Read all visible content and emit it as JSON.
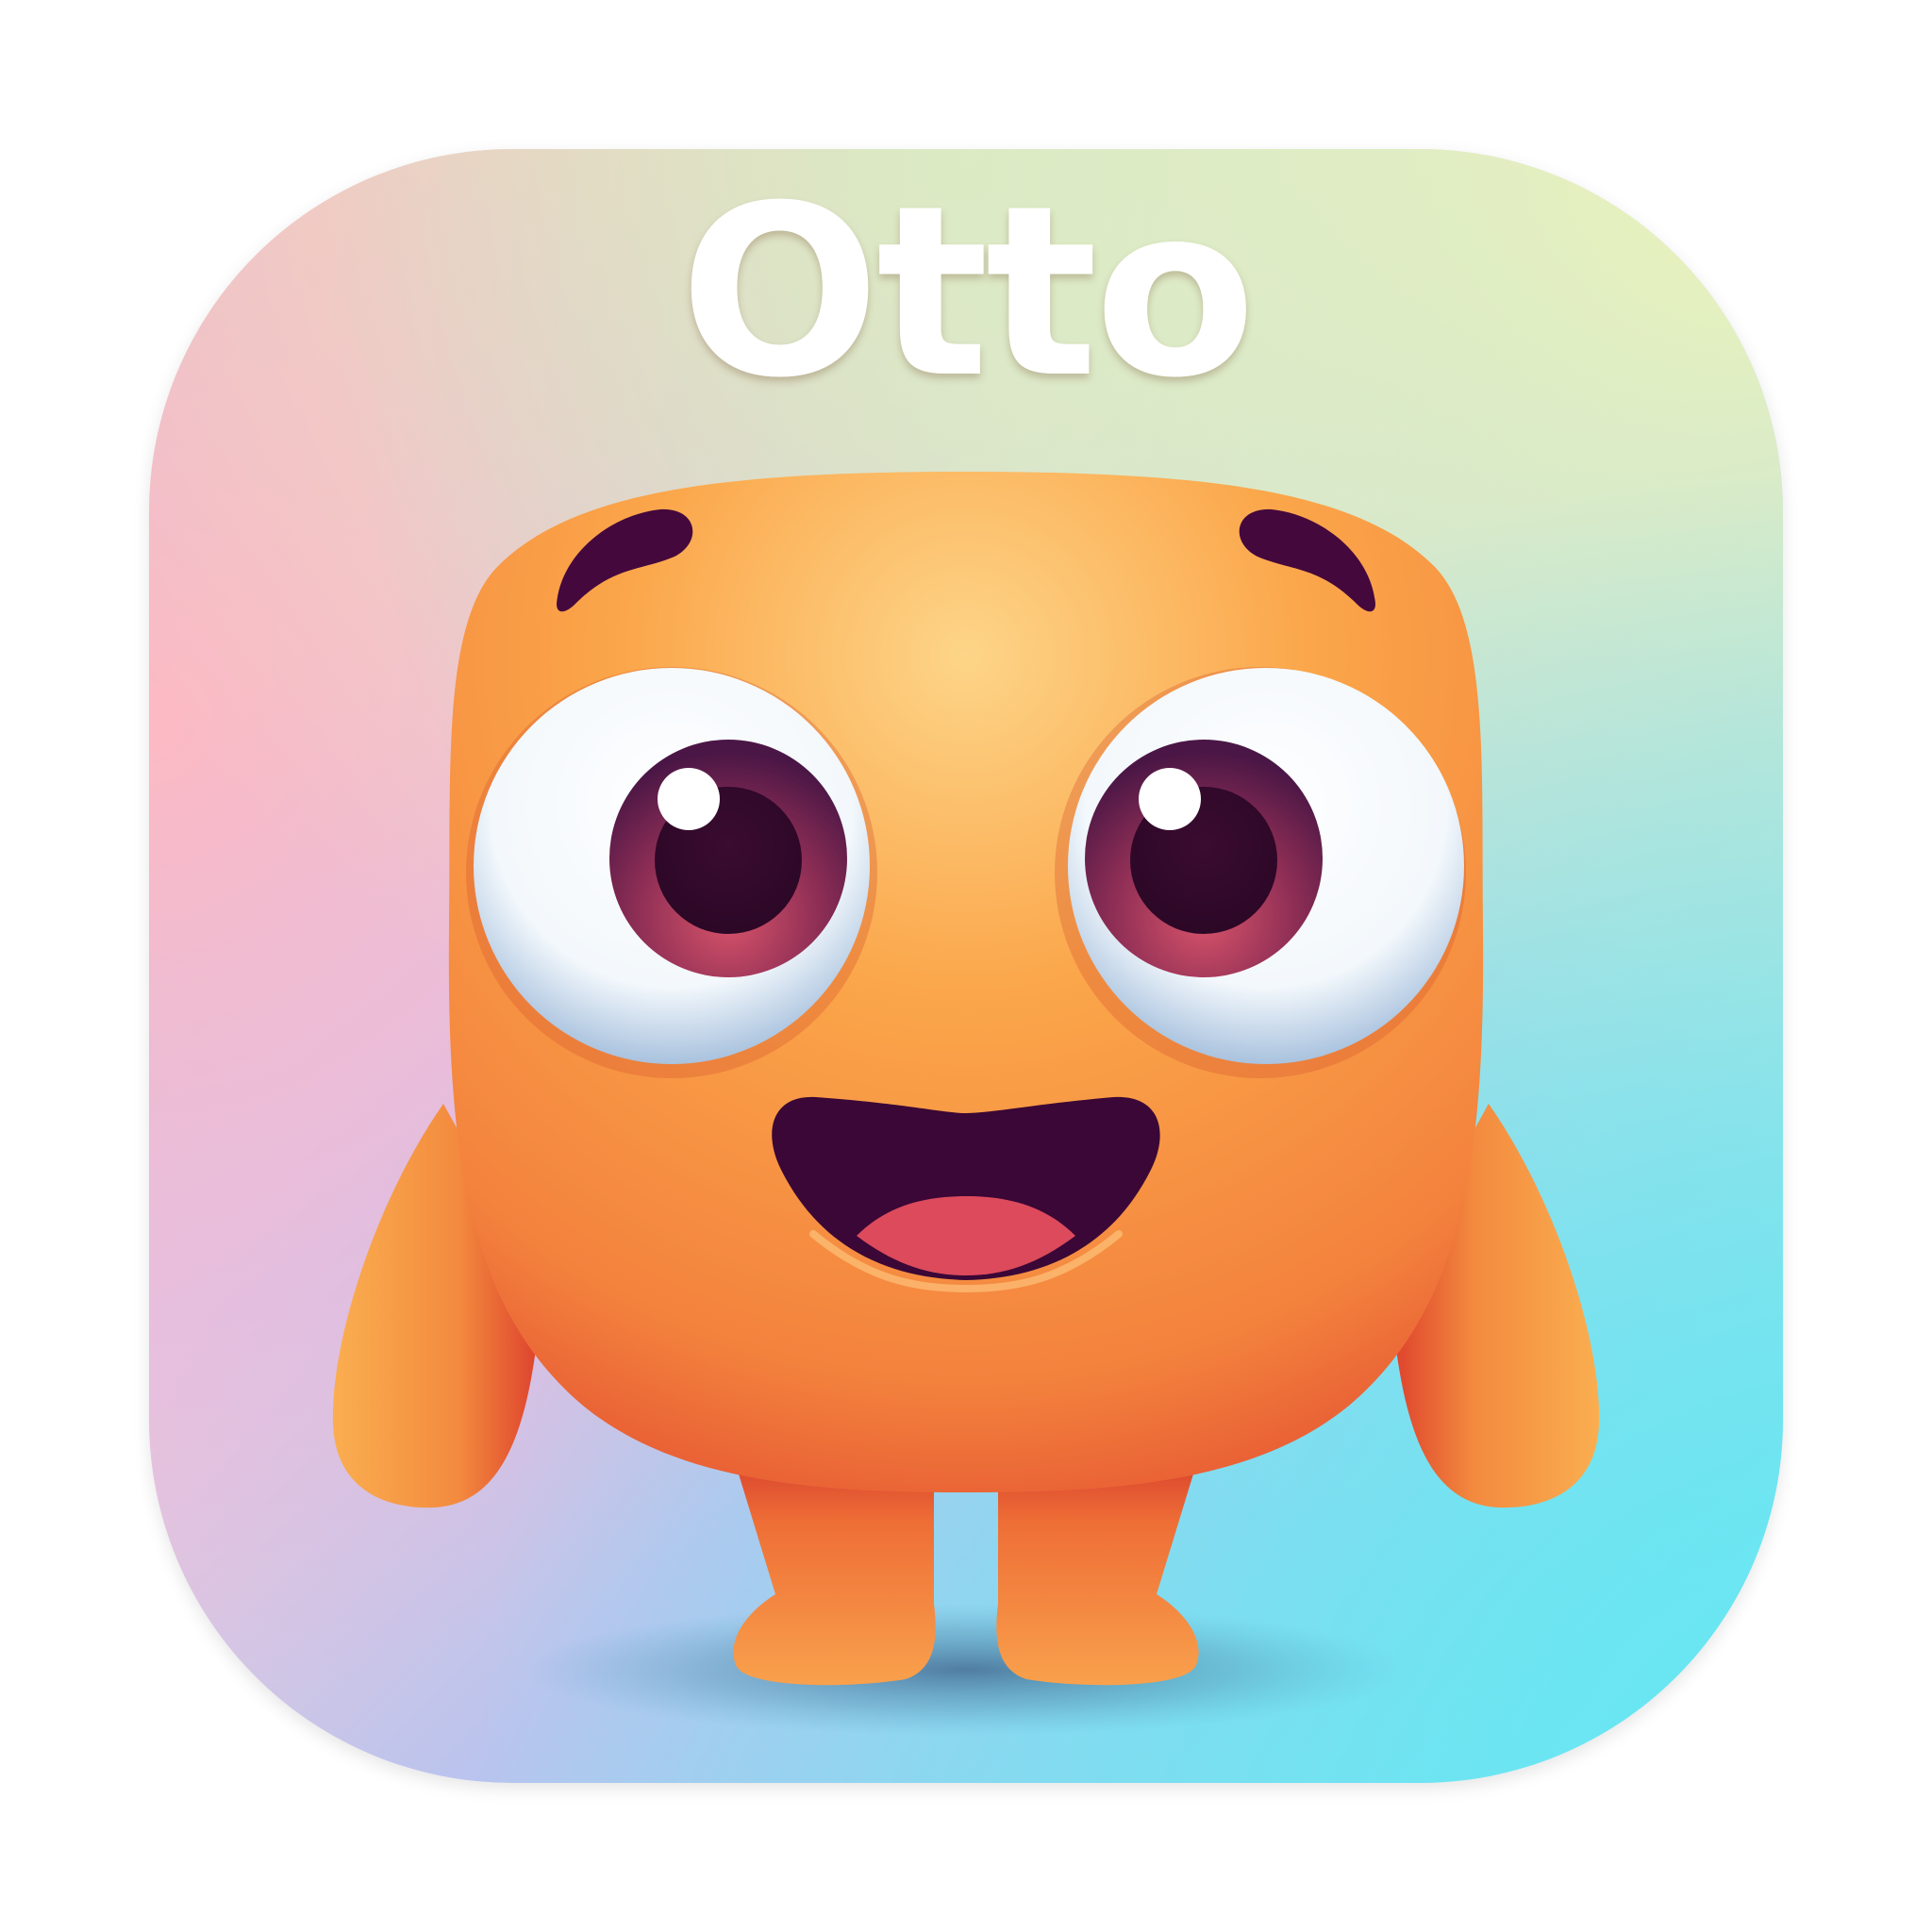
{
  "app": {
    "name": "Otto"
  },
  "icon": {
    "background_gradient_colors": [
      "#FDC3BF",
      "#F9E7B6",
      "#E8F3BE",
      "#D7B2E6",
      "#A9CBF2",
      "#6FE3F0"
    ],
    "mascot_body_color": "#F89A3C",
    "mascot_shade_color": "#E04A2E",
    "eye_iris_color": "#5E1E4E",
    "mouth_color": "#3A0736",
    "tongue_color": "#DC4A5C"
  }
}
